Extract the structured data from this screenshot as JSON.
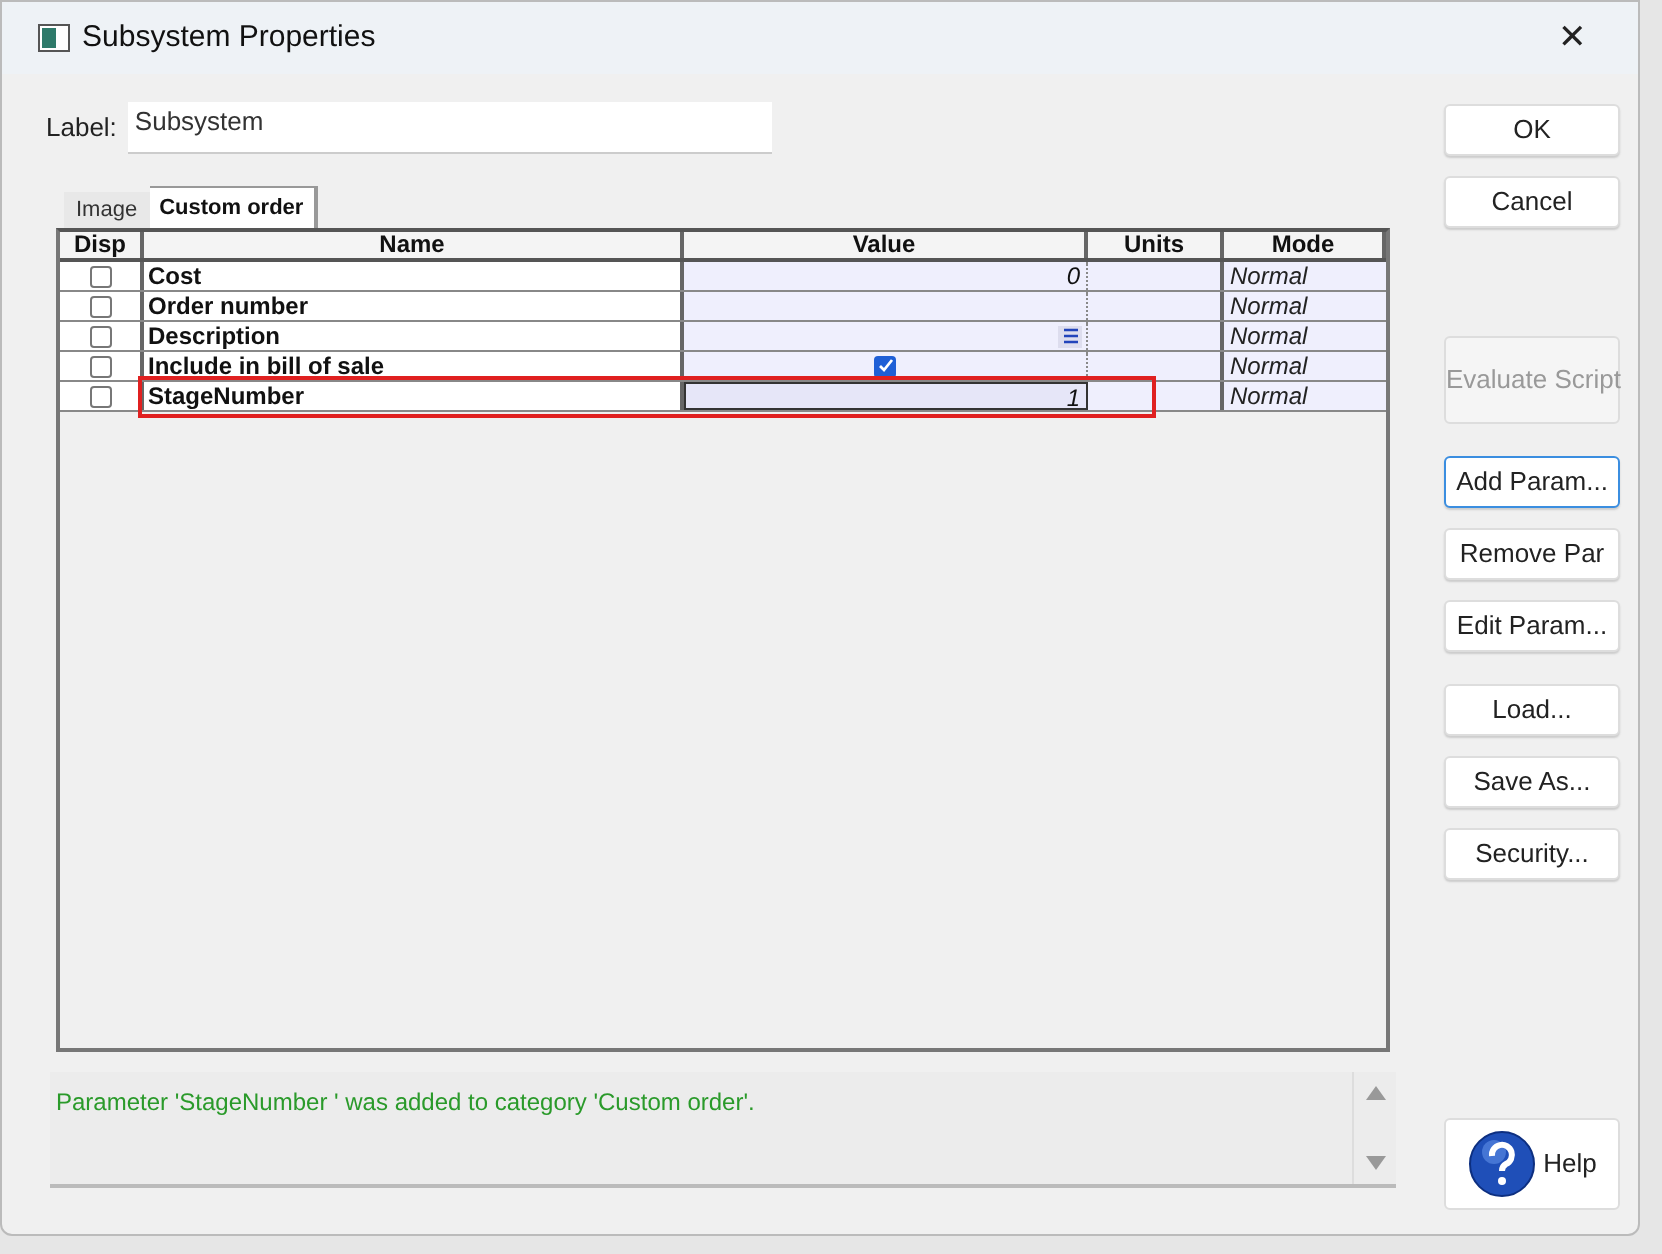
{
  "window": {
    "title": "Subsystem Properties",
    "close": "✕"
  },
  "label_field": {
    "label": "Label:",
    "value": "Subsystem"
  },
  "tabs": [
    {
      "label": "Image",
      "selected": false
    },
    {
      "label": "Custom order",
      "selected": true
    }
  ],
  "table": {
    "columns": [
      "Disp",
      "Name",
      "Value",
      "Units",
      "Mode"
    ],
    "rows": [
      {
        "disp": false,
        "name": "Cost",
        "kind": "text",
        "value": "0",
        "mode": "Normal",
        "highlighted": false
      },
      {
        "disp": false,
        "name": "Order number",
        "kind": "text",
        "mode": "Normal",
        "highlighted": false
      },
      {
        "disp": false,
        "name": "Description",
        "kind": "list",
        "mode": "Normal",
        "highlighted": false
      },
      {
        "disp": false,
        "name": "Include in bill of sale",
        "kind": "checkbox",
        "checked": true,
        "mode": "Normal",
        "highlighted": false
      },
      {
        "disp": false,
        "name": "StageNumber",
        "kind": "text",
        "value": "1",
        "mode": "Normal",
        "highlighted": true
      }
    ]
  },
  "message": "Parameter 'StageNumber ' was added to category 'Custom order'.",
  "button_groups": [
    [
      {
        "label": "OK",
        "disabled": false,
        "focused": false
      },
      {
        "label": "Cancel",
        "disabled": false,
        "focused": false
      }
    ],
    [
      {
        "label": "Evaluate Script",
        "disabled": true,
        "focused": false
      }
    ],
    [
      {
        "label": "Add Param...",
        "disabled": false,
        "focused": true
      },
      {
        "label": "Remove Par",
        "disabled": false,
        "focused": false
      },
      {
        "label": "Edit Param...",
        "disabled": false,
        "focused": false
      }
    ],
    [
      {
        "label": "Load...",
        "disabled": false,
        "focused": false
      },
      {
        "label": "Save As...",
        "disabled": false,
        "focused": false
      },
      {
        "label": "Security...",
        "disabled": false,
        "focused": false
      }
    ]
  ],
  "help_button": {
    "label": "Help"
  }
}
